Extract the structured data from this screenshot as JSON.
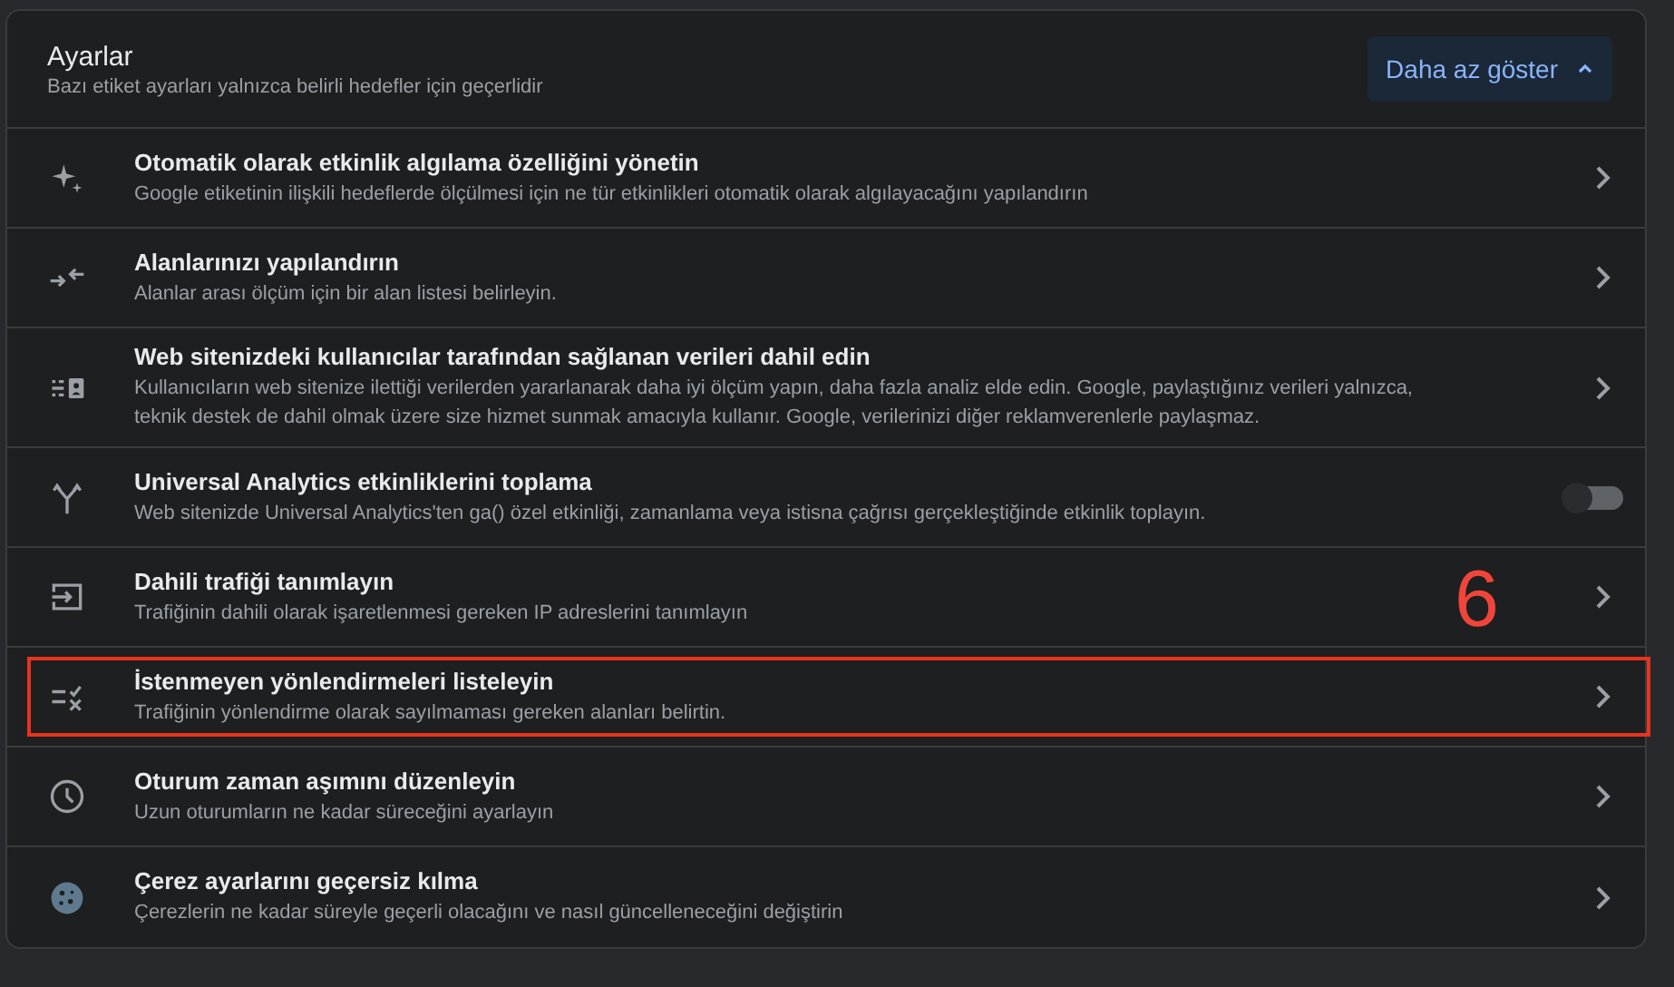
{
  "header": {
    "title": "Ayarlar",
    "subtitle": "Bazı etiket ayarları yalnızca belirli hedefler için geçerlidir",
    "toggle_button": {
      "label": "Daha az göster",
      "expanded": true
    }
  },
  "rows": [
    {
      "kind": "link",
      "title": "Otomatik olarak etkinlik algılama özelliğini yönetin",
      "description": "Google etiketinin ilişkili hedeflerde ölçülmesi için ne tür etkinlikleri otomatik olarak algılayacağını yapılandırın",
      "highlighted": false
    },
    {
      "kind": "link",
      "title": "Alanlarınızı yapılandırın",
      "description": "Alanlar arası ölçüm için bir alan listesi belirleyin.",
      "highlighted": false
    },
    {
      "kind": "link",
      "title": "Web sitenizdeki kullanıcılar tarafından sağlanan verileri dahil edin",
      "description": "Kullanıcıların web sitenize ilettiği verilerden yararlanarak daha iyi ölçüm yapın, daha fazla analiz elde edin. Google, paylaştığınız verileri yalnızca, teknik destek de dahil olmak üzere size hizmet sunmak amacıyla kullanır. Google, verilerinizi diğer reklamverenlerle paylaşmaz.",
      "highlighted": false
    },
    {
      "kind": "toggle",
      "title": "Universal Analytics etkinliklerini toplama",
      "description": "Web sitenizde Universal Analytics'ten ga() özel etkinliği, zamanlama veya istisna çağrısı gerçekleştiğinde etkinlik toplayın.",
      "on": false,
      "highlighted": false
    },
    {
      "kind": "link",
      "title": "Dahili trafiği tanımlayın",
      "description": "Trafiğinin dahili olarak işaretlenmesi gereken IP adreslerini tanımlayın",
      "highlighted": false
    },
    {
      "kind": "link",
      "title": "İstenmeyen yönlendirmeleri listeleyin",
      "description": "Trafiğinin yönlendirme olarak sayılmaması gereken alanları belirtin.",
      "highlighted": true
    },
    {
      "kind": "link",
      "title": "Oturum zaman aşımını düzenleyin",
      "description": "Uzun oturumların ne kadar süreceğini ayarlayın",
      "highlighted": false
    },
    {
      "kind": "link",
      "title": "Çerez ayarlarını geçersiz kılma",
      "description": "Çerezlerin ne kadar süreyle geçerli olacağını ve nasıl güncelleneceğini değiştirin",
      "highlighted": false
    }
  ],
  "annotation": {
    "label": "6"
  }
}
